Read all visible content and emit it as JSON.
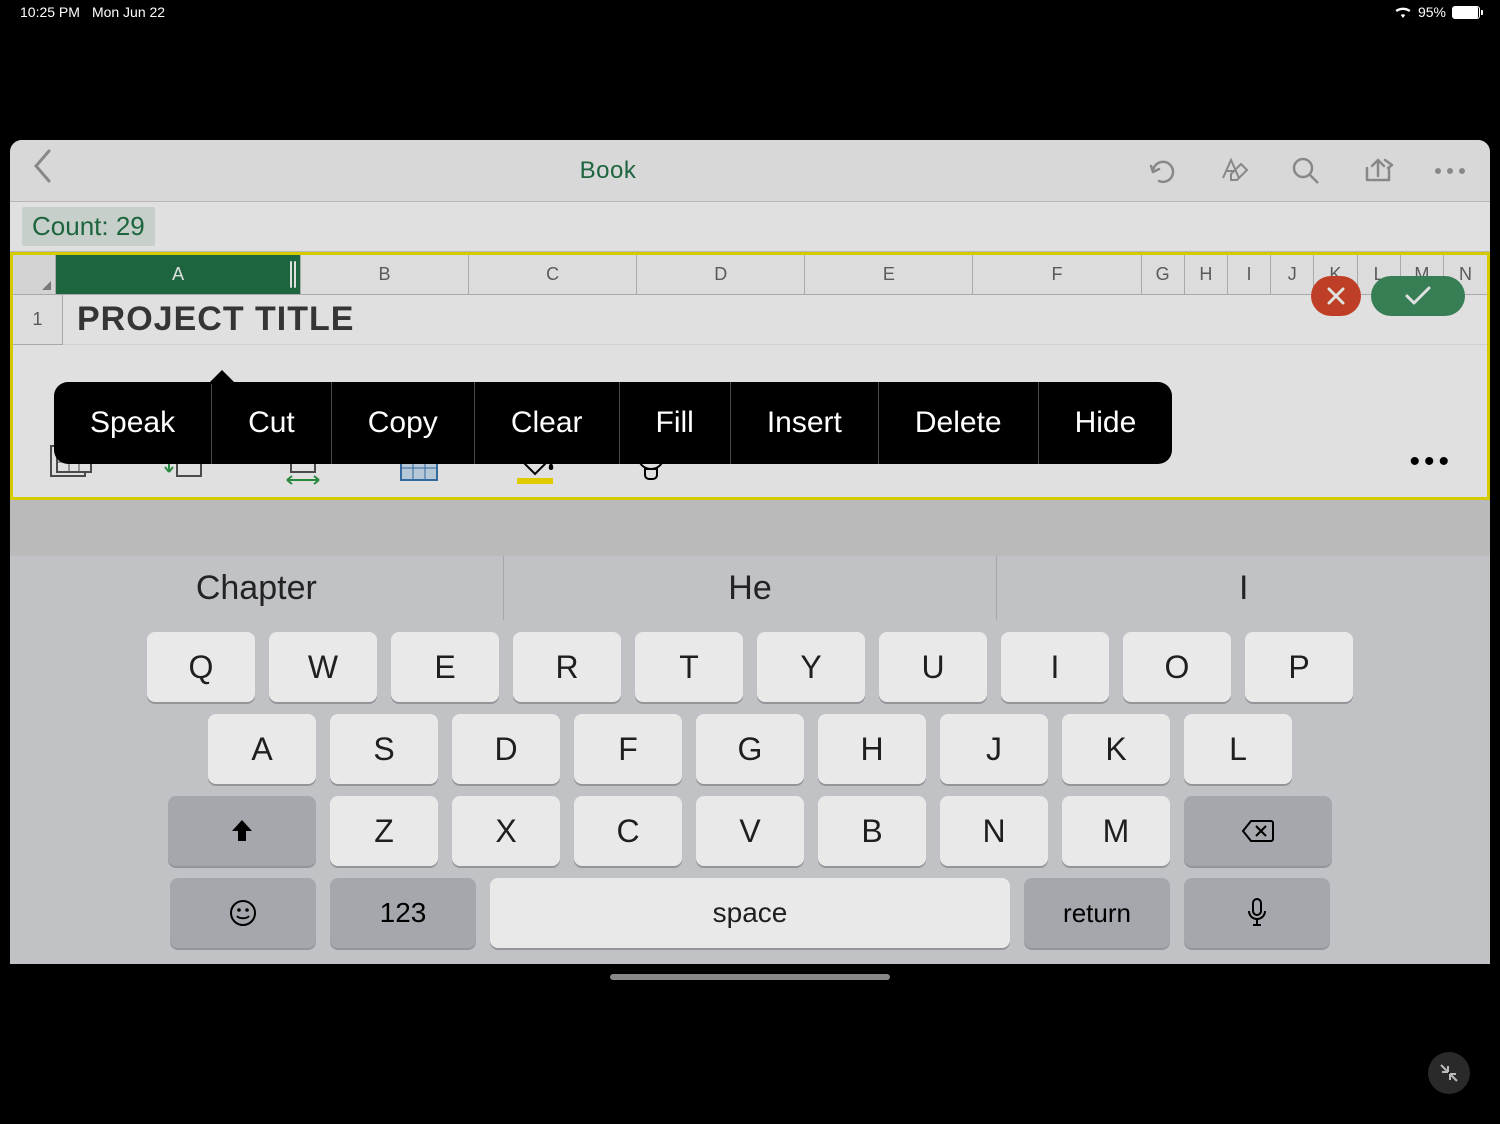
{
  "status": {
    "time": "10:25 PM",
    "date": "Mon Jun 22",
    "battery": "95%"
  },
  "toolbar": {
    "title": "Book"
  },
  "formula_bar": {
    "summary": "Count: 29"
  },
  "columns": [
    "A",
    "B",
    "C",
    "D",
    "E",
    "F",
    "G",
    "H",
    "I",
    "J",
    "K",
    "L",
    "M",
    "N"
  ],
  "selected_column": "A",
  "row1_label": "1",
  "cell_a1": "PROJECT TITLE",
  "context_menu": [
    "Speak",
    "Cut",
    "Copy",
    "Clear",
    "Fill",
    "Insert",
    "Delete",
    "Hide"
  ],
  "predictions": [
    "Chapter",
    "He",
    "I"
  ],
  "keyboard": {
    "row1": [
      "Q",
      "W",
      "E",
      "R",
      "T",
      "Y",
      "U",
      "I",
      "O",
      "P"
    ],
    "row2": [
      "A",
      "S",
      "D",
      "F",
      "G",
      "H",
      "J",
      "K",
      "L"
    ],
    "row3": [
      "Z",
      "X",
      "C",
      "V",
      "B",
      "N",
      "M"
    ],
    "numeric": "123",
    "space": "space",
    "return": "return"
  }
}
